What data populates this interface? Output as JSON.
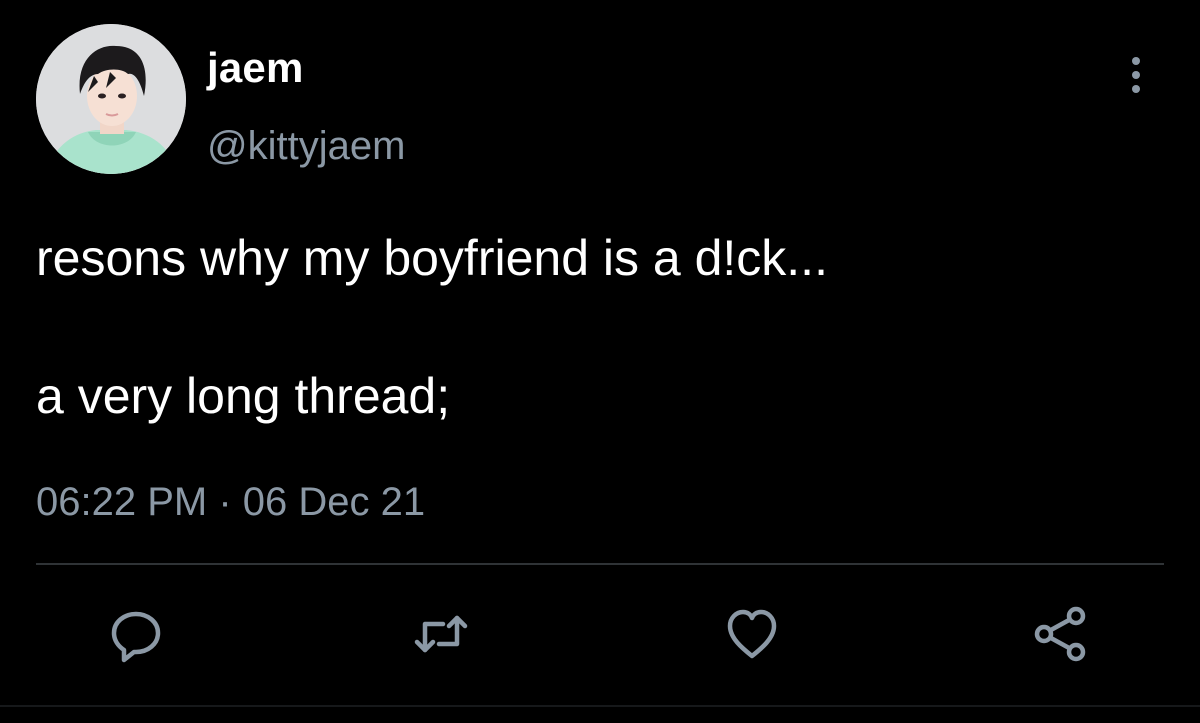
{
  "tweet": {
    "author": {
      "display_name": "jaem",
      "handle": "@kittyjaem",
      "avatar_icon": "profile-photo"
    },
    "text_lines": [
      "resons why my boyfriend is a d!ck...",
      "a very long thread;"
    ],
    "timestamp": "06:22 PM · 06 Dec 21",
    "actions": [
      {
        "name": "reply",
        "icon": "speech-bubble-icon"
      },
      {
        "name": "retweet",
        "icon": "retweet-arrows-icon"
      },
      {
        "name": "like",
        "icon": "heart-icon"
      },
      {
        "name": "share",
        "icon": "share-nodes-icon"
      }
    ],
    "more_icon": "vertical-ellipsis-icon"
  },
  "colors": {
    "background": "#000000",
    "primary_text": "#ffffff",
    "secondary_text": "#8b98a5",
    "divider": "#2f3336",
    "hoodie": "#a9e3cc"
  }
}
